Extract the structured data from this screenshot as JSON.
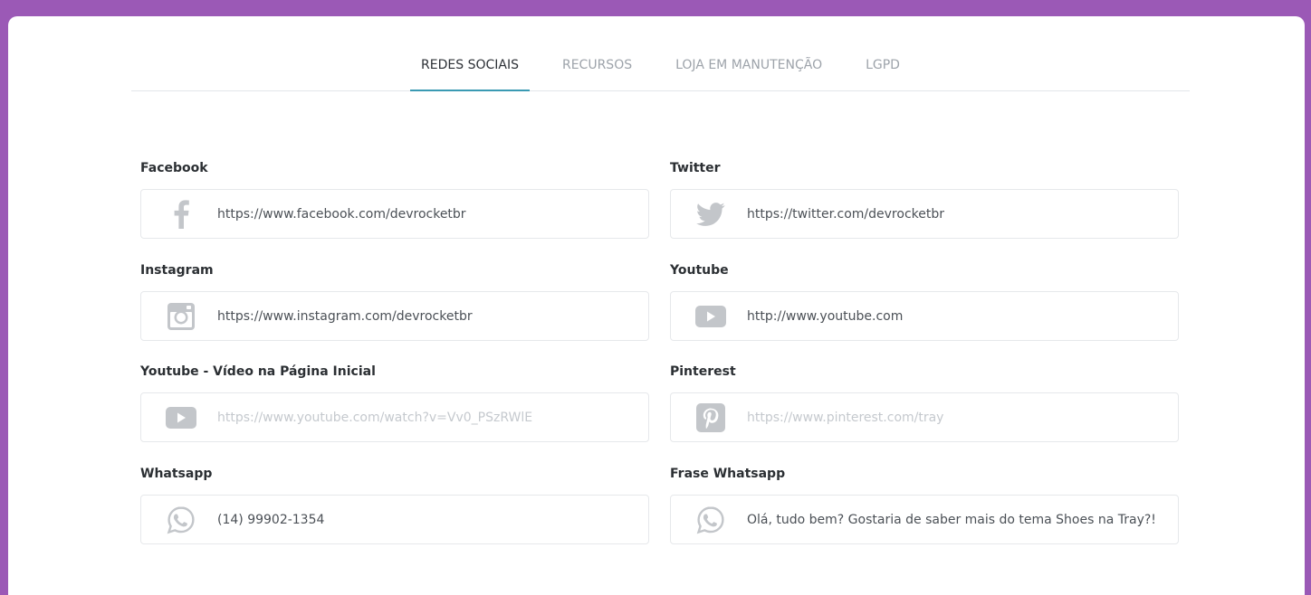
{
  "tabs": [
    {
      "label": "REDES SOCIAIS",
      "active": true
    },
    {
      "label": "RECURSOS",
      "active": false
    },
    {
      "label": "LOJA EM MANUTENÇÃO",
      "active": false
    },
    {
      "label": "LGPD",
      "active": false
    }
  ],
  "fields": {
    "facebook": {
      "label": "Facebook",
      "value": "https://www.facebook.com/devrocketbr",
      "icon": "facebook-icon"
    },
    "twitter": {
      "label": "Twitter",
      "value": "https://twitter.com/devrocketbr",
      "icon": "twitter-icon"
    },
    "instagram": {
      "label": "Instagram",
      "value": "https://www.instagram.com/devrocketbr",
      "icon": "instagram-icon"
    },
    "youtube": {
      "label": "Youtube",
      "value": "http://www.youtube.com",
      "icon": "youtube-icon"
    },
    "youtube_home": {
      "label": "Youtube - Vídeo na Página Inicial",
      "placeholder": "https://www.youtube.com/watch?v=Vv0_PSzRWlE",
      "icon": "youtube-icon"
    },
    "pinterest": {
      "label": "Pinterest",
      "placeholder": "https://www.pinterest.com/tray",
      "icon": "pinterest-icon"
    },
    "whatsapp": {
      "label": "Whatsapp",
      "value": "(14) 99902-1354",
      "icon": "whatsapp-icon"
    },
    "whatsapp_phrase": {
      "label": "Frase Whatsapp",
      "value": "Olá, tudo bem? Gostaria de saber mais do tema Shoes na Tray?!",
      "icon": "whatsapp-icon"
    }
  },
  "colors": {
    "frame": "#9b59b6",
    "tab_active_underline": "#3a9ab3",
    "icon_gray": "#c3c6ca"
  }
}
